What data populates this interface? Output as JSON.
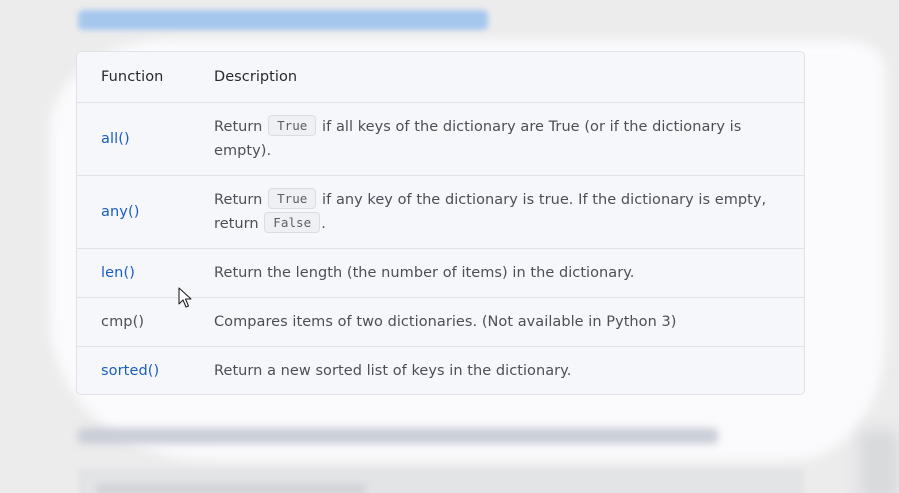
{
  "table": {
    "header": {
      "function": "Function",
      "description": "Description"
    },
    "rows": [
      {
        "function": "all()",
        "is_link": true,
        "desc": {
          "pre": "Return ",
          "code": "True",
          "mid": " if all keys of the dictionary are True (or if the dictionary is empty).",
          "code2": "",
          "post": ""
        }
      },
      {
        "function": "any()",
        "is_link": true,
        "desc": {
          "pre": "Return ",
          "code": "True",
          "mid": " if any key of the dictionary is true. If the dictionary is empty, return ",
          "code2": "False",
          "post": "."
        }
      },
      {
        "function": "len()",
        "is_link": true,
        "desc": {
          "pre": "Return the length (the number of items) in the dictionary.",
          "code": "",
          "mid": "",
          "code2": "",
          "post": ""
        }
      },
      {
        "function": "cmp()",
        "is_link": false,
        "desc": {
          "pre": "Compares items of two dictionaries. (Not available in Python 3)",
          "code": "",
          "mid": "",
          "code2": "",
          "post": ""
        }
      },
      {
        "function": "sorted()",
        "is_link": true,
        "desc": {
          "pre": "Return a new sorted list of keys in the dictionary.",
          "code": "",
          "mid": "",
          "code2": "",
          "post": ""
        }
      }
    ]
  },
  "colors": {
    "link": "#1b5dbf",
    "text": "#4b4f57",
    "table_bg": "#f6f7fb",
    "border": "#dfe2e8"
  },
  "cursor": {
    "icon": "mouse-pointer-icon"
  }
}
